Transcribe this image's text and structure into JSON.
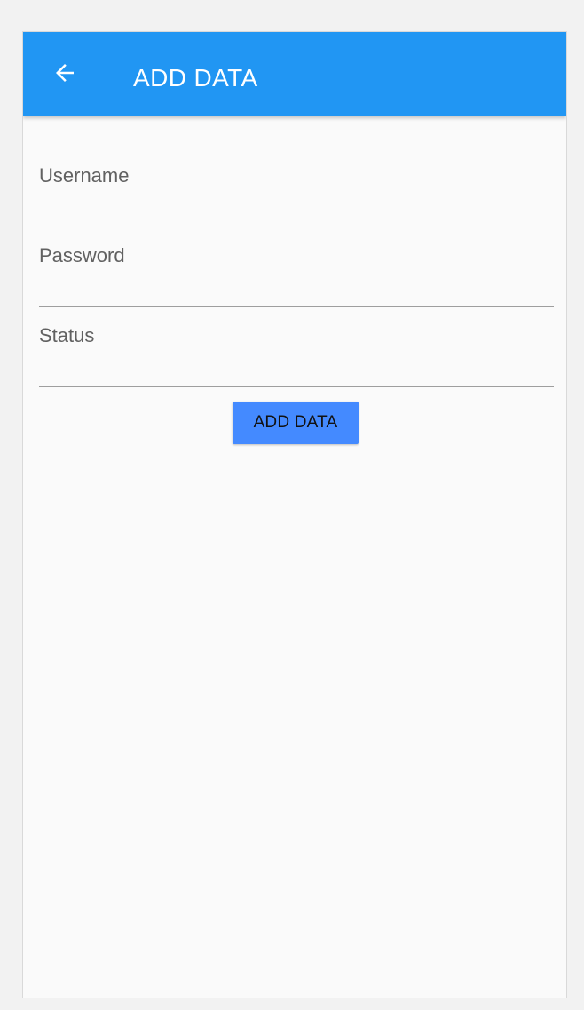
{
  "app_bar": {
    "title": "ADD DATA",
    "back_icon": "arrow-left-icon",
    "background": "#2196f3"
  },
  "form": {
    "fields": [
      {
        "placeholder": "Username",
        "value": ""
      },
      {
        "placeholder": "Password",
        "value": ""
      },
      {
        "placeholder": "Status",
        "value": ""
      }
    ],
    "submit_label": "ADD DATA",
    "button_color": "#448aff"
  }
}
